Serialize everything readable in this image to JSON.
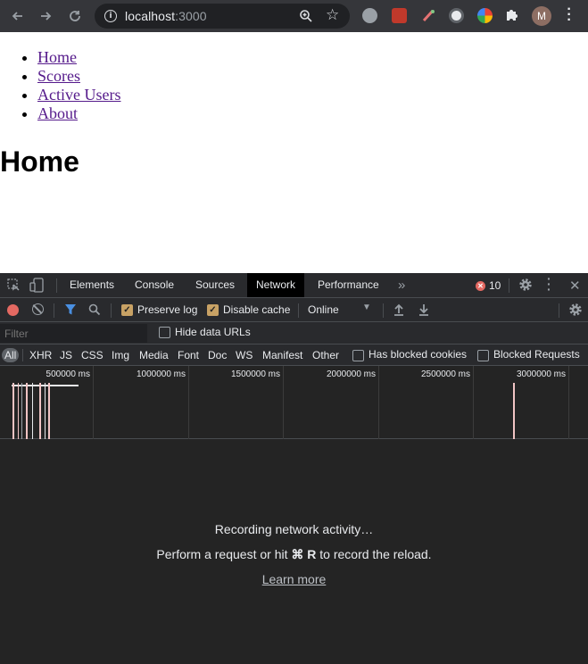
{
  "browser": {
    "url_host": "localhost",
    "url_port": ":3000",
    "avatar_initial": "M"
  },
  "page": {
    "nav": [
      {
        "label": "Home"
      },
      {
        "label": "Scores"
      },
      {
        "label": "Active Users"
      },
      {
        "label": "About"
      }
    ],
    "title": "Home"
  },
  "devtools": {
    "tabs": [
      {
        "label": "Elements"
      },
      {
        "label": "Console"
      },
      {
        "label": "Sources"
      },
      {
        "label": "Network",
        "active": true
      },
      {
        "label": "Performance"
      }
    ],
    "more_tabs": "»",
    "error_count": "10",
    "toolbar": {
      "preserve_log": "Preserve log",
      "disable_cache": "Disable cache",
      "throttle": "Online"
    },
    "filter": {
      "placeholder": "Filter",
      "hide_data_urls": "Hide data URLs"
    },
    "types": [
      "All",
      "XHR",
      "JS",
      "CSS",
      "Img",
      "Media",
      "Font",
      "Doc",
      "WS",
      "Manifest",
      "Other"
    ],
    "has_blocked_cookies": "Has blocked cookies",
    "blocked_requests": "Blocked Requests",
    "timeline_ticks": [
      "500000 ms",
      "1000000 ms",
      "1500000 ms",
      "2000000 ms",
      "2500000 ms",
      "3000000 ms"
    ],
    "empty": {
      "title": "Recording network activity…",
      "hint_prefix": "Perform a request or hit",
      "hint_keys": "⌘ R",
      "hint_suffix": "to record the reload.",
      "learn_more": "Learn more"
    }
  },
  "colors": {
    "accent_record": "#e46962",
    "checkbox_on": "#c8a265",
    "link_visited": "#551a8b"
  }
}
